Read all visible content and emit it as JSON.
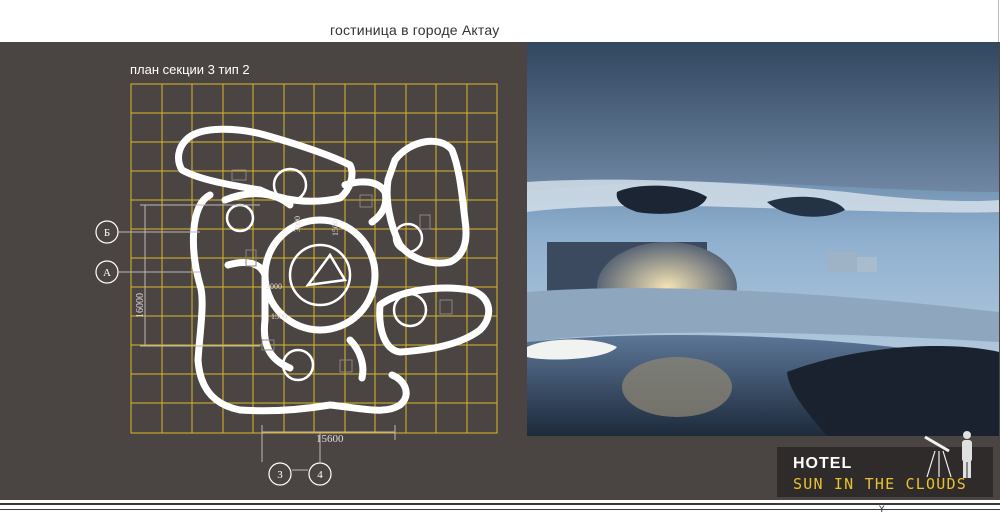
{
  "header": {
    "title": "гостиница в городе Актау"
  },
  "plan": {
    "title": "план секции 3 тип 2",
    "axis_labels": {
      "b": "Б",
      "a": "А",
      "three": "3",
      "four": "4"
    },
    "dimensions": {
      "width_total": "15600",
      "height_total": "16000",
      "dim_3000_v": "3000",
      "dim_1500_v": "1500",
      "dim_3000_h": "3000",
      "dim_1500_h": "1500"
    },
    "grid_color": "#d9b827",
    "wall_color": "#ffffff"
  },
  "brand": {
    "name": "HOTEL",
    "tagline": "SUN IN THE CLOUDS",
    "tagline_color": "#e8c233"
  },
  "footer": {
    "mark": "Y"
  }
}
